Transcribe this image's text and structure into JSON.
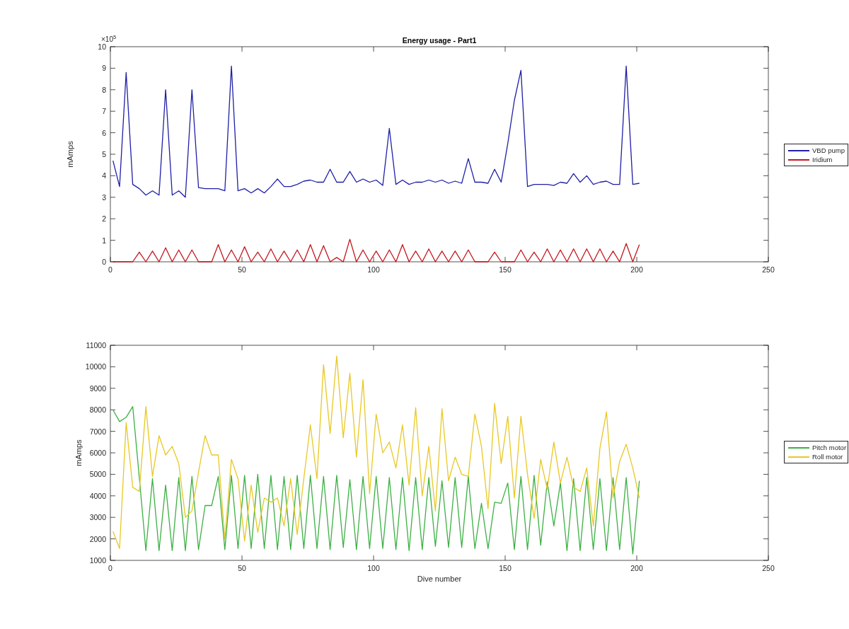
{
  "charts": [
    {
      "scale": {
        "base": "×10",
        "exponent": "5"
      },
      "chart_data": {
        "type": "line",
        "title": "Energy usage - Part1",
        "ylabel": "mAmps",
        "x": [
          1,
          3.5,
          6,
          8.5,
          11,
          13.5,
          16,
          18.5,
          21,
          23.5,
          26,
          28.5,
          31,
          33.5,
          36,
          38.5,
          41,
          43.5,
          46,
          48.5,
          51,
          53.5,
          56,
          58.5,
          61,
          63.5,
          66,
          68.5,
          71,
          73.5,
          76,
          78.5,
          81,
          83.5,
          86,
          88.5,
          91,
          93.5,
          96,
          98.5,
          101,
          103.5,
          106,
          108.5,
          111,
          113.5,
          116,
          118.5,
          121,
          123.5,
          126,
          128.5,
          131,
          133.5,
          136,
          138.5,
          141,
          143.5,
          146,
          148.5,
          151,
          153.5,
          156,
          158.5,
          161,
          163.5,
          166,
          168.5,
          171,
          173.5,
          176,
          178.5,
          181,
          183.5,
          186,
          188.5,
          191,
          193.5,
          196,
          198.5,
          201
        ],
        "series": [
          {
            "name": "VBD pump",
            "color": "#1f1fa8",
            "values": [
              4.7,
              3.5,
              8.8,
              3.6,
              3.4,
              3.1,
              3.3,
              3.1,
              8.0,
              3.1,
              3.3,
              3.0,
              8.0,
              3.45,
              3.4,
              3.4,
              3.4,
              3.3,
              9.1,
              3.3,
              3.4,
              3.2,
              3.4,
              3.2,
              3.5,
              3.85,
              3.5,
              3.5,
              3.6,
              3.75,
              3.8,
              3.7,
              3.7,
              4.3,
              3.7,
              3.7,
              4.2,
              3.7,
              3.85,
              3.7,
              3.8,
              3.55,
              6.2,
              3.6,
              3.8,
              3.6,
              3.7,
              3.7,
              3.8,
              3.7,
              3.8,
              3.65,
              3.75,
              3.65,
              4.8,
              3.7,
              3.7,
              3.65,
              4.3,
              3.7,
              5.5,
              7.5,
              8.9,
              3.5,
              3.6,
              3.6,
              3.6,
              3.55,
              3.7,
              3.65,
              4.1,
              3.7,
              4.0,
              3.6,
              3.7,
              3.75,
              3.6,
              3.6,
              9.1,
              3.6,
              3.65
            ]
          },
          {
            "name": "Iridium",
            "color": "#c4161c",
            "values": [
              0,
              0,
              0,
              0,
              0.45,
              0,
              0.5,
              0,
              0.65,
              0,
              0.55,
              0,
              0.55,
              0,
              0,
              0,
              0.8,
              0,
              0.55,
              0,
              0.7,
              0,
              0.45,
              0,
              0.6,
              0,
              0.5,
              0,
              0.55,
              0,
              0.8,
              0,
              0.75,
              0,
              0.2,
              0,
              1.05,
              0,
              0.55,
              0,
              0.5,
              0,
              0.55,
              0,
              0.8,
              0,
              0.5,
              0,
              0.6,
              0,
              0.5,
              0,
              0.5,
              0,
              0.55,
              0,
              0,
              0,
              0.45,
              0,
              0,
              0,
              0.55,
              0,
              0.45,
              0,
              0.6,
              0,
              0.55,
              0,
              0.6,
              0,
              0.6,
              0,
              0.6,
              0,
              0.5,
              0,
              0.85,
              0,
              0.8
            ]
          }
        ],
        "xlim": [
          0,
          250
        ],
        "ylim": [
          0,
          10
        ],
        "xticks": [
          0,
          50,
          100,
          150,
          200,
          250
        ],
        "yticks": [
          0,
          1,
          2,
          3,
          4,
          5,
          6,
          7,
          8,
          9,
          10
        ]
      }
    },
    {
      "chart_data": {
        "type": "line",
        "xlabel": "Dive number",
        "ylabel": "mAmps",
        "x": [
          1,
          3.5,
          6,
          8.5,
          11,
          13.5,
          16,
          18.5,
          21,
          23.5,
          26,
          28.5,
          31,
          33.5,
          36,
          38.5,
          41,
          43.5,
          46,
          48.5,
          51,
          53.5,
          56,
          58.5,
          61,
          63.5,
          66,
          68.5,
          71,
          73.5,
          76,
          78.5,
          81,
          83.5,
          86,
          88.5,
          91,
          93.5,
          96,
          98.5,
          101,
          103.5,
          106,
          108.5,
          111,
          113.5,
          116,
          118.5,
          121,
          123.5,
          126,
          128.5,
          131,
          133.5,
          136,
          138.5,
          141,
          143.5,
          146,
          148.5,
          151,
          153.5,
          156,
          158.5,
          161,
          163.5,
          166,
          168.5,
          171,
          173.5,
          176,
          178.5,
          181,
          183.5,
          186,
          188.5,
          191,
          193.5,
          196,
          198.5,
          201
        ],
        "series": [
          {
            "name": "Pitch motor",
            "color": "#3cb043",
            "values": [
              8000,
              7450,
              7650,
              8150,
              4850,
              1450,
              4800,
              1450,
              4500,
              1450,
              4850,
              1450,
              4900,
              1500,
              3550,
              3550,
              4900,
              1500,
              4950,
              1550,
              4950,
              1550,
              5000,
              1550,
              4950,
              1500,
              4900,
              1500,
              4950,
              1550,
              4950,
              1550,
              4900,
              1500,
              4950,
              1600,
              4750,
              1500,
              4900,
              1550,
              4900,
              1550,
              4850,
              1500,
              4850,
              1450,
              4850,
              1500,
              4850,
              1650,
              4700,
              1600,
              4850,
              1600,
              4900,
              1550,
              3650,
              1550,
              3700,
              3650,
              4600,
              1500,
              4900,
              1500,
              4950,
              1700,
              4650,
              2600,
              4600,
              1450,
              4800,
              1450,
              4850,
              1500,
              4800,
              1450,
              4850,
              1500,
              4850,
              1300,
              4700
            ]
          },
          {
            "name": "Roll motor",
            "color": "#e8c824",
            "values": [
              2350,
              1550,
              7400,
              4400,
              4200,
              8150,
              4900,
              6800,
              5900,
              6300,
              5500,
              3000,
              3300,
              5100,
              6800,
              5900,
              5900,
              2000,
              5700,
              4800,
              1900,
              4500,
              2300,
              3900,
              3700,
              3900,
              2600,
              4800,
              2200,
              4800,
              7300,
              4800,
              10100,
              6900,
              10500,
              6700,
              9700,
              5800,
              9400,
              4100,
              7800,
              6000,
              6500,
              5300,
              7300,
              4500,
              8100,
              4000,
              6300,
              3300,
              8050,
              4700,
              5800,
              5000,
              4900,
              7800,
              6300,
              3400,
              8300,
              5500,
              7700,
              3900,
              7700,
              5000,
              2950,
              5700,
              4300,
              6500,
              4600,
              5800,
              4400,
              4200,
              5300,
              2600,
              6200,
              7900,
              3900,
              5600,
              6400,
              5300,
              3900
            ]
          }
        ],
        "xlim": [
          0,
          250
        ],
        "ylim": [
          1000,
          11000
        ],
        "xticks": [
          0,
          50,
          100,
          150,
          200,
          250
        ],
        "yticks": [
          1000,
          2000,
          3000,
          4000,
          5000,
          6000,
          7000,
          8000,
          9000,
          10000,
          11000
        ]
      }
    }
  ]
}
